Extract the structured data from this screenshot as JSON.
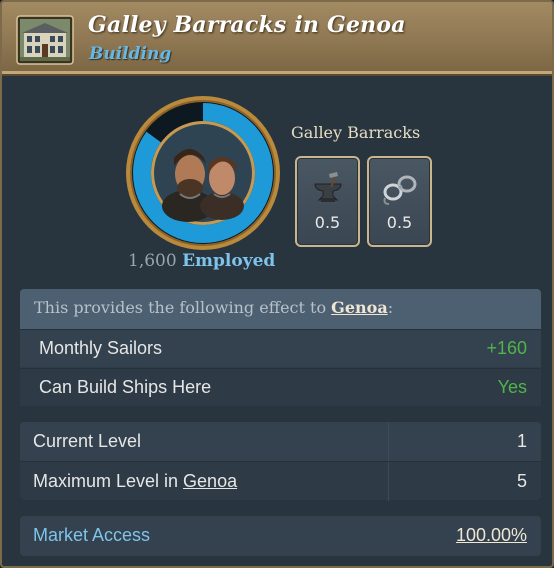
{
  "header": {
    "title": "Galley Barracks in Genoa",
    "subtitle": "Building",
    "icon": "townhouse-icon"
  },
  "workforce": {
    "employed_count": "1,600",
    "employed_label": "Employed",
    "employment_fraction": 0.85,
    "ring_color": "#1e9ad8",
    "portrait_icon": "sailors-portrait"
  },
  "production": {
    "job_title": "Galley Barracks",
    "goods": [
      {
        "icon": "anvil-tools-icon",
        "value": "0.5"
      },
      {
        "icon": "shackles-icon",
        "value": "0.5"
      }
    ]
  },
  "effects": {
    "header_prefix": "This provides the following effect to ",
    "location": "Genoa",
    "header_suffix": ":",
    "rows": [
      {
        "label": "Monthly Sailors",
        "value": "+160"
      },
      {
        "label": "Can Build Ships Here",
        "value": "Yes"
      }
    ],
    "positive_color": "#4fb54a"
  },
  "levels": {
    "current_label": "Current Level",
    "current_value": "1",
    "max_label_prefix": "Maximum Level in ",
    "max_location": "Genoa",
    "max_value": "5"
  },
  "market": {
    "label": "Market Access",
    "value": "100.00%"
  }
}
